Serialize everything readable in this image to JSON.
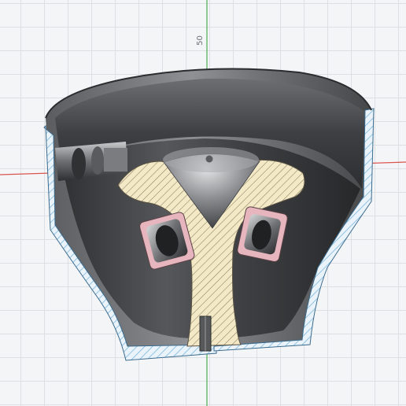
{
  "viewport": {
    "ruler_label": "50",
    "colors": {
      "background": "#f4f5f7",
      "grid": "#dcdfe4",
      "axis_x": "#d9534f",
      "axis_y": "#4caf50",
      "shell_dark": "#4a4c4f",
      "shell_light": "#a4a6a8",
      "section_blue_hatch": "#7db8de",
      "section_tan_fill": "#f3e9c6",
      "section_tan_hatch": "#8a7f62",
      "bearing_pink": "#e7b5bd"
    },
    "icons": [
      "cone-tip",
      "bearing",
      "bolt",
      "pin"
    ]
  }
}
